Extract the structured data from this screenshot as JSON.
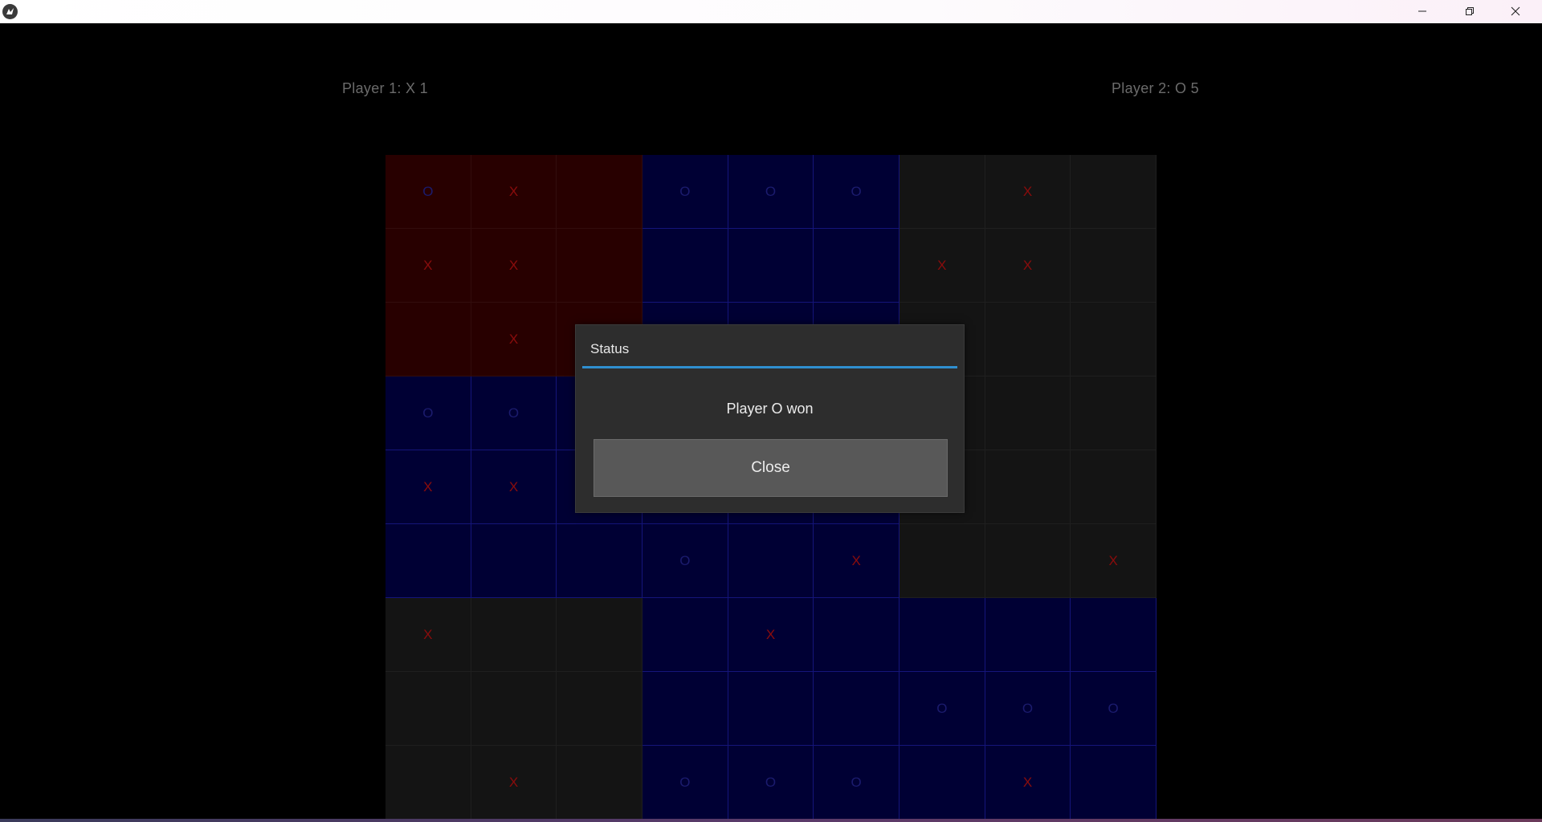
{
  "window": {
    "icons": {
      "app": "kivy-icon",
      "minimize": "minimize-icon",
      "maximize": "restore-icon",
      "close": "close-icon"
    }
  },
  "scores": {
    "player1": "Player 1: X  1",
    "player2": "Player 2: O   5"
  },
  "colors": {
    "red_board": "#280000",
    "blue_board": "#000034",
    "neutral_board": "#141414",
    "accent": "#2f8fcf",
    "x_mark": "#8a0c0c",
    "o_mark": "#1b1b6e"
  },
  "board": [
    {
      "state": "red",
      "cells": [
        "O",
        "X",
        "",
        "X",
        "X",
        "",
        "",
        "X",
        ""
      ]
    },
    {
      "state": "blue",
      "cells": [
        "O",
        "O",
        "O",
        "",
        "",
        "",
        "",
        "",
        ""
      ]
    },
    {
      "state": "gray",
      "cells": [
        "",
        "X",
        "",
        "X",
        "X",
        "",
        "",
        "",
        ""
      ]
    },
    {
      "state": "blue",
      "cells": [
        "O",
        "O",
        "",
        "X",
        "X",
        "",
        "",
        "",
        ""
      ]
    },
    {
      "state": "blue",
      "cells": [
        "",
        "",
        "",
        "",
        "",
        "",
        "O",
        "",
        "X"
      ]
    },
    {
      "state": "gray",
      "cells": [
        "",
        "",
        "",
        "",
        "",
        "",
        "",
        "",
        "X"
      ]
    },
    {
      "state": "gray",
      "cells": [
        "X",
        "",
        "",
        "",
        "",
        "",
        "",
        "X",
        ""
      ]
    },
    {
      "state": "blue",
      "cells": [
        "",
        "X",
        "",
        "",
        "",
        "",
        "O",
        "O",
        "O"
      ]
    },
    {
      "state": "blue",
      "cells": [
        "",
        "",
        "",
        "O",
        "O",
        "O",
        "",
        "X",
        ""
      ]
    }
  ],
  "dialog": {
    "title": "Status",
    "message": "Player O won",
    "close_label": "Close"
  }
}
